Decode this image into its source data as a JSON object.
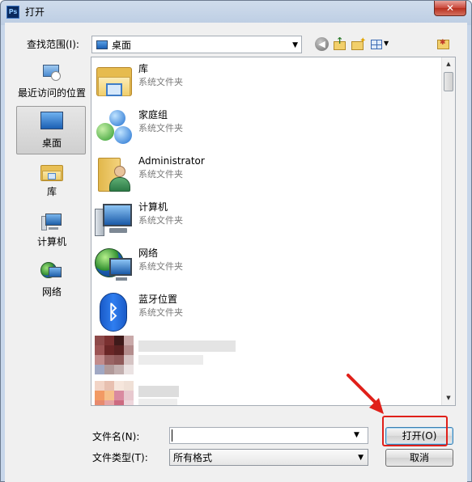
{
  "window": {
    "title": "打开",
    "app_icon_text": "Ps",
    "close_glyph": "✕"
  },
  "lookin": {
    "label": "查找范围(I):",
    "value": "桌面",
    "arrow": "▼"
  },
  "toolbar": {
    "back_glyph": "◀",
    "up_glyph": "↑",
    "new_folder_glyph": "✦",
    "view_dd_glyph": "▼",
    "extra_glyph": "✱"
  },
  "places": [
    {
      "label": "最近访问的位置",
      "icon": "recent-places-icon"
    },
    {
      "label": "桌面",
      "icon": "desktop-icon",
      "selected": true
    },
    {
      "label": "库",
      "icon": "libraries-icon"
    },
    {
      "label": "计算机",
      "icon": "computer-icon"
    },
    {
      "label": "网络",
      "icon": "network-icon"
    }
  ],
  "files": [
    {
      "name": "库",
      "type": "系统文件夹",
      "icon": "libraries-icon"
    },
    {
      "name": "家庭组",
      "type": "系统文件夹",
      "icon": "homegroup-icon"
    },
    {
      "name": "Administrator",
      "type": "系统文件夹",
      "icon": "user-folder-icon"
    },
    {
      "name": "计算机",
      "type": "系统文件夹",
      "icon": "computer-icon"
    },
    {
      "name": "网络",
      "type": "系统文件夹",
      "icon": "network-icon"
    },
    {
      "name": "蓝牙位置",
      "type": "系统文件夹",
      "icon": "bluetooth-icon"
    }
  ],
  "scroll": {
    "up": "▲",
    "down": "▼"
  },
  "bottom": {
    "filename_label": "文件名(N):",
    "filename_value": "",
    "filename_dd": "▼",
    "filetype_label": "文件类型(T):",
    "filetype_value": "所有格式",
    "filetype_dd": "▼",
    "open_label": "打开(O)",
    "cancel_label": "取消"
  },
  "colors": {
    "highlight": "#e0201a",
    "selection": "#cfcfcf"
  }
}
